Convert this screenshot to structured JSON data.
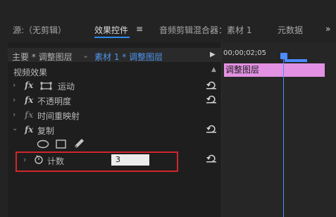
{
  "tabs": {
    "source": "源:（无剪辑）",
    "effect_controls": "效果控件",
    "menu_icon": "≡",
    "audio_mixer": "音频剪辑混合器：素材 1",
    "metadata": "元数据",
    "overflow": "»"
  },
  "header": {
    "master_label": "主要 * 调整图层",
    "sequence_label": "素材 1 * 调整图层",
    "timecode": "00;00;02;05"
  },
  "section": {
    "title": "视频效果"
  },
  "effects": [
    {
      "name": "运动",
      "icon": "motion-icon"
    },
    {
      "name": "不透明度"
    },
    {
      "name": "时间重映射"
    },
    {
      "name": "复制"
    }
  ],
  "copy_param": {
    "label": "计数",
    "value": "3"
  },
  "timeline": {
    "clip_label": "调整图层"
  },
  "colors": {
    "accent": "#2d8ceb",
    "clip": "#e392e3",
    "highlight": "#d2262b",
    "playhead": "#4d8bff"
  }
}
